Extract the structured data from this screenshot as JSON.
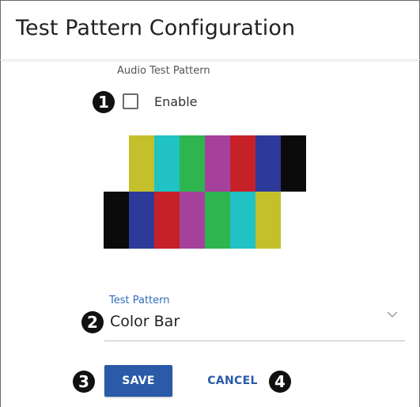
{
  "header": {
    "title": "Test Pattern Configuration"
  },
  "audio": {
    "section_label": "Audio Test Pattern",
    "enable_label": "Enable",
    "enabled": false
  },
  "color_bars": {
    "top_row": [
      "#c4c02c",
      "#20c2c4",
      "#2fb550",
      "#a5419b",
      "#c62129",
      "#2e3a9a",
      "#0b0b0b"
    ],
    "bottom_row": [
      "#0b0b0b",
      "#2e3a9a",
      "#c62129",
      "#a5419b",
      "#2fb550",
      "#20c2c4",
      "#c4c02c"
    ]
  },
  "test_pattern": {
    "label": "Test Pattern",
    "value": "Color Bar"
  },
  "buttons": {
    "save_label": "SAVE",
    "cancel_label": "CANCEL"
  },
  "callouts": {
    "one": "1",
    "two": "2",
    "three": "3",
    "four": "4"
  },
  "colors": {
    "accent": "#2a5aa8",
    "label_blue": "#2f6fb8"
  }
}
